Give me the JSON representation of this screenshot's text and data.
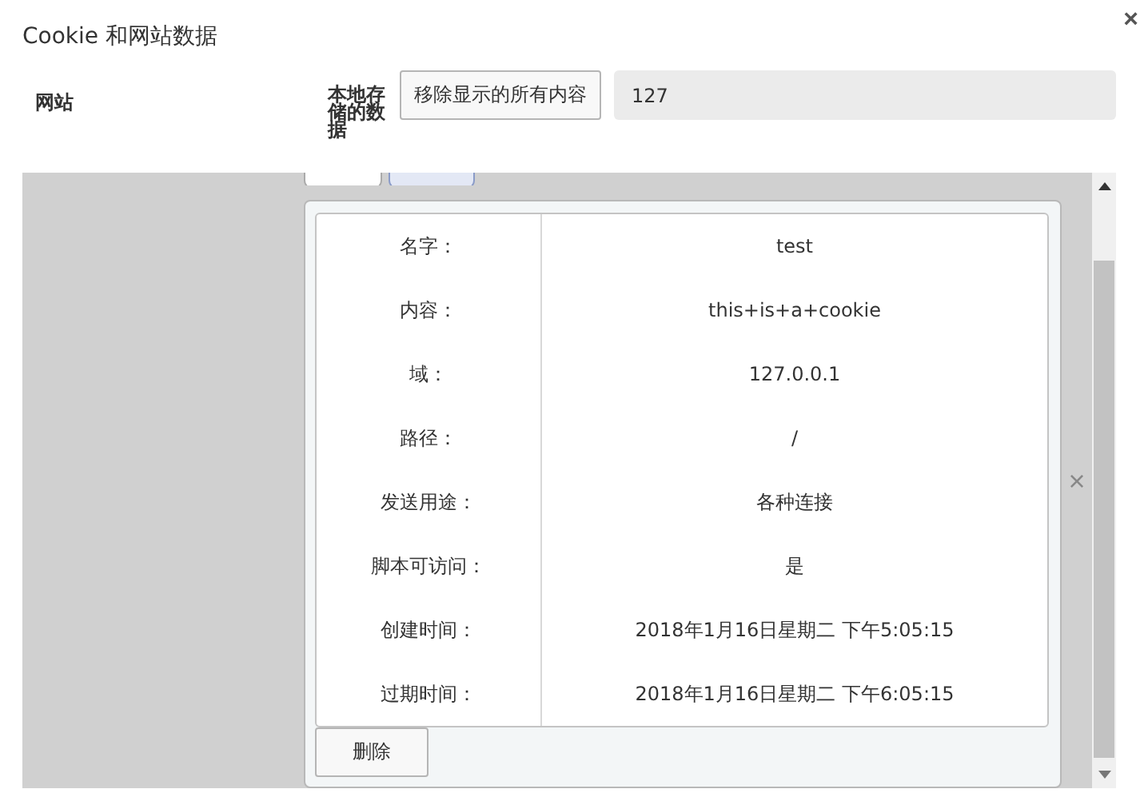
{
  "window": {
    "title": "Cookie 和网站数据",
    "close": "×"
  },
  "header": {
    "site_label": "网站",
    "storage_label": "本地存储的数据",
    "remove_all_button": "移除显示的所有内容",
    "search_value": "127"
  },
  "list": {
    "item_remove": "×",
    "chips": [
      {
        "selected": false
      },
      {
        "selected": true
      }
    ],
    "details": [
      {
        "label": "名字：",
        "value": "test"
      },
      {
        "label": "内容：",
        "value": "this+is+a+cookie"
      },
      {
        "label": "域：",
        "value": "127.0.0.1"
      },
      {
        "label": "路径：",
        "value": "/"
      },
      {
        "label": "发送用途：",
        "value": "各种连接"
      },
      {
        "label": "脚本可访问：",
        "value": "是"
      },
      {
        "label": "创建时间：",
        "value": "2018年1月16日星期二 下午5:05:15"
      },
      {
        "label": "过期时间：",
        "value": "2018年1月16日星期二 下午6:05:15"
      }
    ],
    "delete_button": "删除"
  }
}
